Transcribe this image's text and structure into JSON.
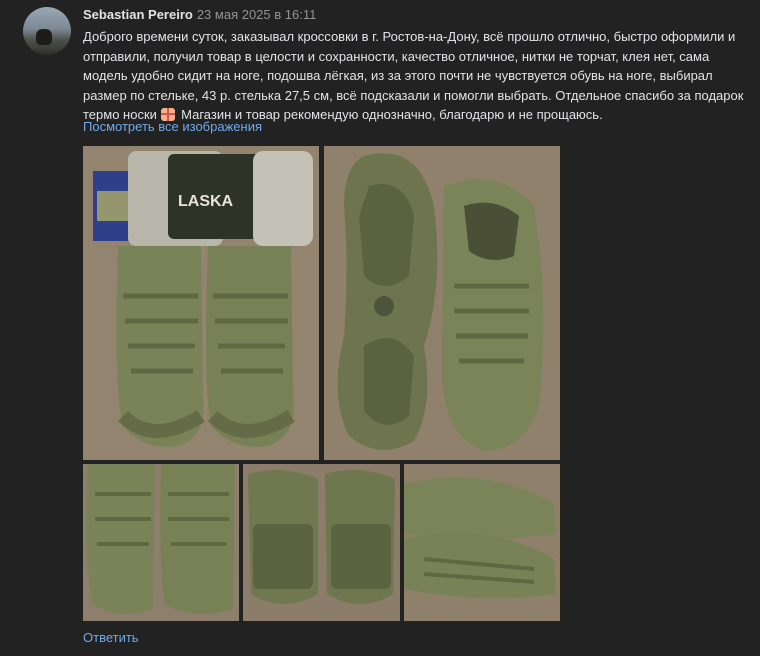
{
  "comment": {
    "author": "Sebastian Pereiro",
    "date": "23 мая 2025 в 16:11",
    "text_before_emoji": "Доброго времени суток, заказывал кроссовки в г. Ростов-на-Дону, всё прошло отлично, быстро оформили и отправили, получил товар в целости и сохранности, качество отличное, нитки не торчат, клея нет, сама модель удобно сидит на ноге, подошва лёгкая, из за этого почти не чувствуется обувь на ноге, выбирал размер по стельке, 43 р. стелька 27,5 см, всё подсказали и помогли выбрать. Отдельное спасибо за подарок термо носки ",
    "emoji_icon": "gift-icon",
    "text_after_emoji": " Магазин и товар рекомендую однозначно, благодарю и не прощаюсь.",
    "see_all_images": "Посмотреть все изображения",
    "reply": "Ответить",
    "sock_brand": "LASKA"
  },
  "colors": {
    "background": "#222222",
    "link": "#71aaeb",
    "text": "#e1e3e6",
    "muted": "#939393"
  }
}
